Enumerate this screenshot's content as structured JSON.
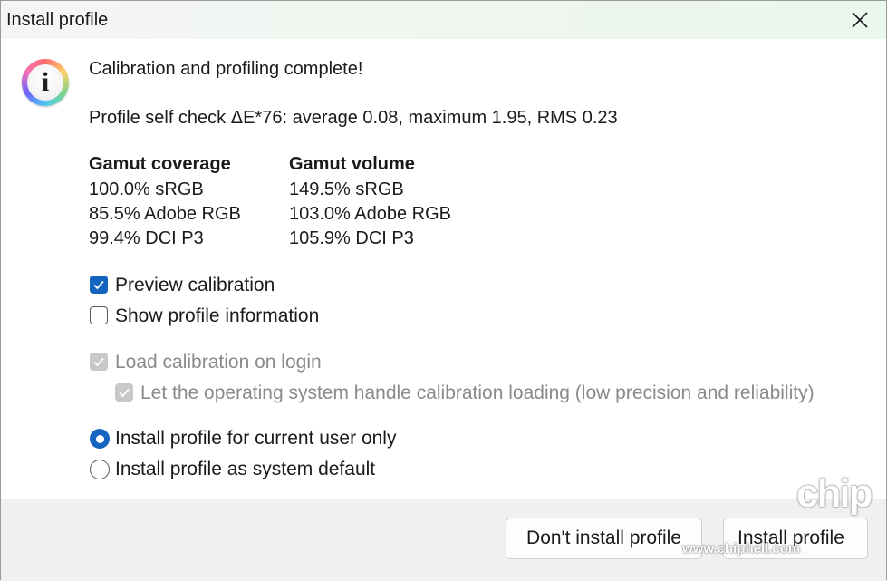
{
  "window": {
    "title": "Install profile"
  },
  "message": {
    "heading": "Calibration and profiling complete!",
    "self_check": "Profile self check ΔE*76: average 0.08, maximum 1.95, RMS 0.23"
  },
  "gamut": {
    "coverage_header": "Gamut coverage",
    "volume_header": "Gamut volume",
    "coverage": [
      "100.0% sRGB",
      "85.5% Adobe RGB",
      "99.4% DCI P3"
    ],
    "volume": [
      "149.5% sRGB",
      "103.0% Adobe RGB",
      "105.9% DCI P3"
    ]
  },
  "options": {
    "preview_calibration": "Preview calibration",
    "show_profile_info": "Show profile information",
    "load_calibration_login": "Load calibration on login",
    "os_handle_calibration": "Let the operating system handle calibration loading (low precision and reliability)",
    "install_current_user": "Install profile for current user only",
    "install_system_default": "Install profile as system default",
    "preview_calibration_checked": true,
    "show_profile_info_checked": false,
    "load_calibration_login_checked": true,
    "os_handle_calibration_checked": true,
    "install_scope": "current_user"
  },
  "buttons": {
    "dont_install": "Don't install profile",
    "install": "Install profile"
  },
  "watermark": {
    "site": "www.chiphell.com",
    "logo": "chip"
  },
  "icons": {
    "info": "info-icon",
    "close": "close-icon",
    "check": "checkmark-icon"
  },
  "colors": {
    "accent": "#1565c0",
    "disabled": "#c8c8c8"
  }
}
